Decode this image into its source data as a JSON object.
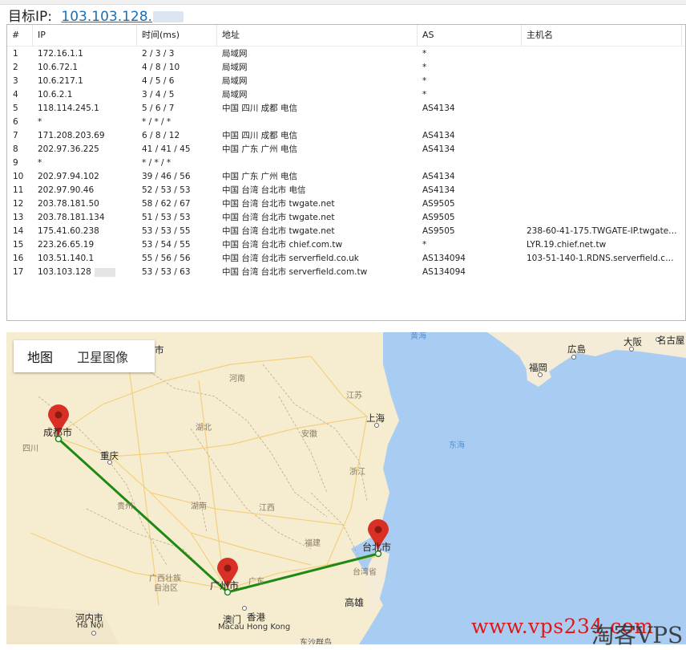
{
  "target": {
    "label": "目标IP:",
    "ip": "103.103.128."
  },
  "table": {
    "headers": [
      "#",
      "IP",
      "时间(ms)",
      "地址",
      "AS",
      "主机名"
    ],
    "rows": [
      [
        "1",
        "172.16.1.1",
        "2 / 3 / 3",
        "局域网",
        "*",
        ""
      ],
      [
        "2",
        "10.6.72.1",
        "4 / 8 / 10",
        "局域网",
        "*",
        ""
      ],
      [
        "3",
        "10.6.217.1",
        "4 / 5 / 6",
        "局域网",
        "*",
        ""
      ],
      [
        "4",
        "10.6.2.1",
        "3 / 4 / 5",
        "局域网",
        "*",
        ""
      ],
      [
        "5",
        "118.114.245.1",
        "5 / 6 / 7",
        "中国 四川 成都 电信",
        "AS4134",
        ""
      ],
      [
        "6",
        "*",
        "* / * / *",
        "",
        "",
        ""
      ],
      [
        "7",
        "171.208.203.69",
        "6 / 8 / 12",
        "中国 四川 成都 电信",
        "AS4134",
        ""
      ],
      [
        "8",
        "202.97.36.225",
        "41 / 41 / 45",
        "中国 广东 广州 电信",
        "AS4134",
        ""
      ],
      [
        "9",
        "*",
        "* / * / *",
        "",
        "",
        ""
      ],
      [
        "10",
        "202.97.94.102",
        "39 / 46 / 56",
        "中国 广东 广州 电信",
        "AS4134",
        ""
      ],
      [
        "11",
        "202.97.90.46",
        "52 / 53 / 53",
        "中国 台湾 台北市 电信",
        "AS4134",
        ""
      ],
      [
        "12",
        "203.78.181.50",
        "58 / 62 / 67",
        "中国 台湾 台北市 twgate.net",
        "AS9505",
        ""
      ],
      [
        "13",
        "203.78.181.134",
        "51 / 53 / 53",
        "中国 台湾 台北市 twgate.net",
        "AS9505",
        ""
      ],
      [
        "14",
        "175.41.60.238",
        "53 / 53 / 55",
        "中国 台湾 台北市 twgate.net",
        "AS9505",
        "238-60-41-175.TWGATE-IP.twgate...."
      ],
      [
        "15",
        "223.26.65.19",
        "53 / 54 / 55",
        "中国 台湾 台北市 chief.com.tw",
        "*",
        "LYR.19.chief.net.tw"
      ],
      [
        "16",
        "103.51.140.1",
        "55 / 56 / 56",
        "中国 台湾 台北市 serverfield.co.uk",
        "AS134094",
        "103-51-140-1.RDNS.serverfield.com..."
      ],
      [
        "17",
        "103.103.128",
        "53 / 53 / 63",
        "中国 台湾 台北市 serverfield.com.tw",
        "AS134094",
        ""
      ]
    ]
  },
  "map": {
    "tabs": [
      "地图",
      "卫星图像"
    ],
    "labels": {
      "chengdu": "成都市",
      "guangzhou": "广州市",
      "taipei": "台北市",
      "chongqing": "重庆",
      "shanghai": "上海",
      "kaohsiung": "高雄",
      "hongkong": "香港",
      "macau": "澳门",
      "macau_hk_en": "Macau Hong Kong",
      "hanoi": "河内市",
      "hanoi_en": "Hà Nội",
      "hiroshima": "広島",
      "osaka": "大阪",
      "nagoya": "名古屋",
      "fukuoka": "福岡",
      "sichuan": "四川",
      "guizhou": "贵州",
      "hunan": "湖南",
      "hubei": "湖北",
      "henan": "河南",
      "anhui": "安徽",
      "jiangxi": "江西",
      "jiangsu": "江苏",
      "zhejiang": "浙江",
      "fujian": "福建",
      "guangdong": "广东",
      "guangxi": "广西壮族",
      "guangxi2": "自治区",
      "taiwan": "台湾省",
      "east_sea": "东海",
      "yellow_sea": "黄海",
      "dongsha": "东沙群岛",
      "city_top": "市"
    },
    "route_color": "#1e8a12",
    "pin_color": "#d93025"
  },
  "watermark": {
    "text": "www.vps234.com",
    "text2": "淘客VPS"
  }
}
